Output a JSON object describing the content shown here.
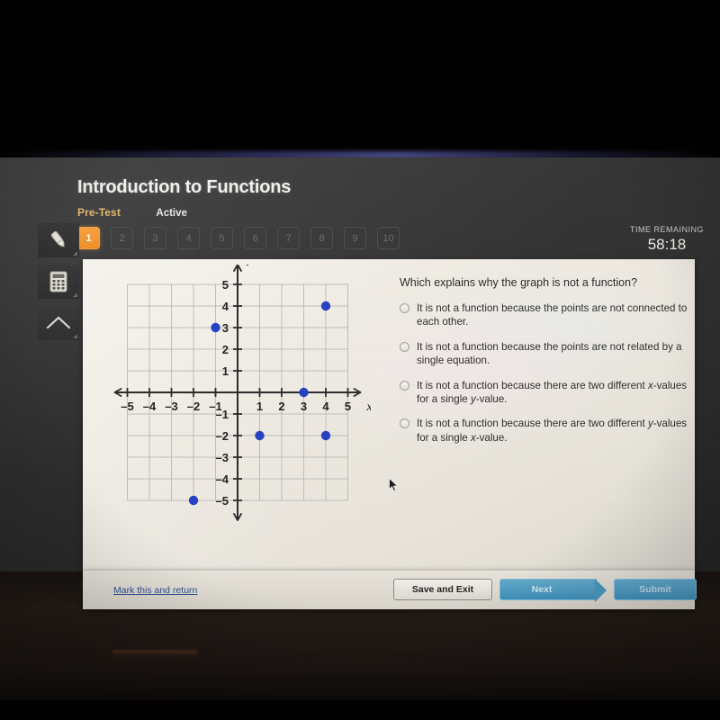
{
  "header": {
    "title": "Introduction to Functions",
    "test_label": "Pre-Test",
    "status_label": "Active"
  },
  "pager": {
    "items": [
      {
        "label": "1",
        "active": true
      },
      {
        "label": "2",
        "active": false
      },
      {
        "label": "3",
        "active": false
      },
      {
        "label": "4",
        "active": false
      },
      {
        "label": "5",
        "active": false
      },
      {
        "label": "6",
        "active": false
      },
      {
        "label": "7",
        "active": false
      },
      {
        "label": "8",
        "active": false
      },
      {
        "label": "9",
        "active": false
      },
      {
        "label": "10",
        "active": false
      }
    ]
  },
  "timer": {
    "label": "TIME REMAINING",
    "value": "58:18"
  },
  "tools": [
    {
      "name": "highlighter-icon"
    },
    {
      "name": "calculator-icon"
    },
    {
      "name": "chevron-up-icon"
    }
  ],
  "question": {
    "prompt": "Which explains why the graph is not a function?",
    "options": [
      {
        "id": "a",
        "text": "It is not a function because the points are not connected to each other.",
        "selected": false
      },
      {
        "id": "b",
        "text": "It is not a function because the points are not related by a single equation.",
        "selected": false
      },
      {
        "id": "c",
        "text": "It is not a function because there are two different x-values for a single y-value.",
        "selected": false
      },
      {
        "id": "d",
        "text": "It is not a function because there are two different y-values for a single x-value.",
        "selected": false
      }
    ]
  },
  "footer": {
    "mark_link": "Mark this and return",
    "save_exit": "Save and Exit",
    "next": "Next",
    "submit": "Submit"
  },
  "chart_data": {
    "type": "scatter",
    "title": "",
    "xlabel": "x",
    "ylabel": "y",
    "xlim": [
      -5,
      5
    ],
    "ylim": [
      -5,
      5
    ],
    "xticks": [
      -5,
      -4,
      -3,
      -2,
      -1,
      1,
      2,
      3,
      4,
      5
    ],
    "yticks": [
      5,
      4,
      3,
      2,
      1,
      -1,
      -2,
      -3,
      -4,
      -5
    ],
    "grid": true,
    "grid_color": "#b9b7b0",
    "axis_color": "#2b2b2b",
    "point_color": "#2740c4",
    "legend": "none",
    "points": [
      {
        "x": -2,
        "y": -5
      },
      {
        "x": -1,
        "y": 3
      },
      {
        "x": 1,
        "y": -2
      },
      {
        "x": 3,
        "y": 0
      },
      {
        "x": 4,
        "y": 4
      },
      {
        "x": 4,
        "y": -2
      }
    ]
  }
}
